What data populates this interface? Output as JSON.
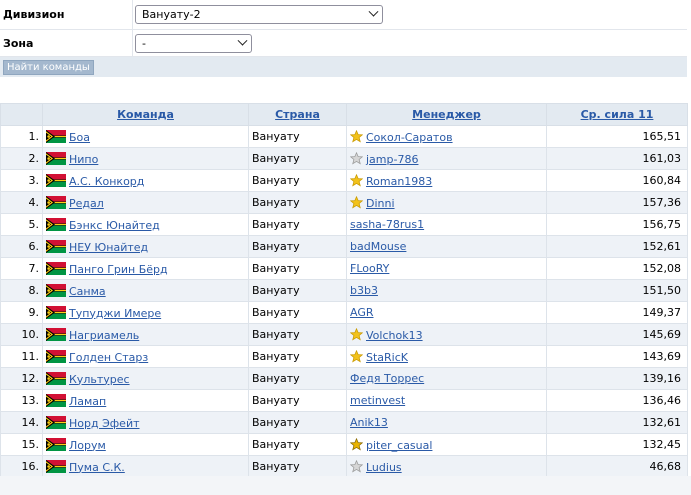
{
  "filter": {
    "division_label": "Дивизион",
    "division_value": "Вануату-2",
    "zone_label": "Зона",
    "zone_value": "-",
    "find_button": "Найти команды"
  },
  "table": {
    "columns": [
      "Команда",
      "Страна",
      "Менеджер",
      "Ср. сила 11"
    ],
    "rows": [
      {
        "rank": "1.",
        "team": "Боа",
        "country": "Вануату",
        "manager": "Сокол-Саратов",
        "star": "gold",
        "power": "165,51"
      },
      {
        "rank": "2.",
        "team": "Нипо",
        "country": "Вануату",
        "manager": "jamp-786",
        "star": "gray",
        "power": "161,03"
      },
      {
        "rank": "3.",
        "team": "А.С. Конкорд",
        "country": "Вануату",
        "manager": "Roman1983",
        "star": "gold",
        "power": "160,84"
      },
      {
        "rank": "4.",
        "team": "Редал",
        "country": "Вануату",
        "manager": "Dinni",
        "star": "gold",
        "power": "157,36"
      },
      {
        "rank": "5.",
        "team": "Бэнкс Юнайтед",
        "country": "Вануату",
        "manager": "sasha-78rus1",
        "star": "",
        "power": "156,75"
      },
      {
        "rank": "6.",
        "team": "НЕУ Юнайтед",
        "country": "Вануату",
        "manager": "badMouse",
        "star": "",
        "power": "152,61"
      },
      {
        "rank": "7.",
        "team": "Панго Грин Бёрд",
        "country": "Вануату",
        "manager": "FLooRY",
        "star": "",
        "power": "152,08"
      },
      {
        "rank": "8.",
        "team": "Санма",
        "country": "Вануату",
        "manager": "b3b3",
        "star": "",
        "power": "151,50"
      },
      {
        "rank": "9.",
        "team": "Тупуджи Имере",
        "country": "Вануату",
        "manager": "AGR",
        "star": "",
        "power": "149,37"
      },
      {
        "rank": "10.",
        "team": "Нагриамель",
        "country": "Вануату",
        "manager": "Volchok13",
        "star": "gold",
        "power": "145,69"
      },
      {
        "rank": "11.",
        "team": "Голден Старз",
        "country": "Вануату",
        "manager": "StaRicK",
        "star": "gold",
        "power": "143,69"
      },
      {
        "rank": "12.",
        "team": "Культурес",
        "country": "Вануату",
        "manager": "Федя Торрес",
        "star": "",
        "power": "139,16"
      },
      {
        "rank": "13.",
        "team": "Ламап",
        "country": "Вануату",
        "manager": "metinvest",
        "star": "",
        "power": "136,46"
      },
      {
        "rank": "14.",
        "team": "Норд Эфейт",
        "country": "Вануату",
        "manager": "Anik13",
        "star": "",
        "power": "132,61"
      },
      {
        "rank": "15.",
        "team": "Лорум",
        "country": "Вануату",
        "manager": "piter_casual",
        "star": "gold-dark",
        "power": "132,45"
      },
      {
        "rank": "16.",
        "team": "Пума С.К.",
        "country": "Вануату",
        "manager": "Ludius",
        "star": "gray",
        "power": "46,68"
      }
    ]
  },
  "icons": {
    "flag": "vanuatu-flag-icon",
    "star": "star-icon"
  },
  "colors": {
    "link": "#2a5aa7",
    "header_bg": "#e3eaf1",
    "row_alt_bg": "#eef2f7",
    "star_gold": "#f2c21b",
    "star_gray": "#b5b5b5"
  }
}
